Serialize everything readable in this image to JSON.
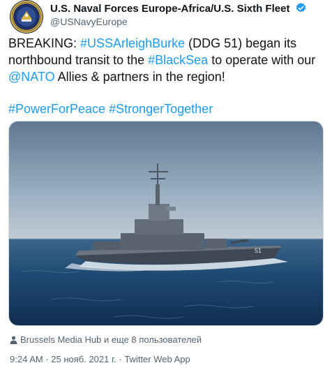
{
  "account": {
    "display_name": "U.S. Naval Forces Europe-Africa/U.S. Sixth Fleet",
    "handle": "@USNavyEurope",
    "avatar_icon": "navy-seal-avatar",
    "verified_icon": "verified-badge-icon"
  },
  "tweet": {
    "line1": {
      "prefix": "BREAKING: ",
      "hashtag1": "#USSArleighBurke",
      "mid1": " (DDG 51) began its northbound transit to the ",
      "hashtag2": "#BlackSea",
      "mid2": " to operate with our ",
      "mention": "@NATO",
      "suffix": " Allies & partners in the region!"
    },
    "line2": {
      "hashtag1": "#PowerForPeace",
      "space": " ",
      "hashtag2": "#StrongerTogether"
    }
  },
  "media": {
    "subject_icon": "destroyer-ship-photo",
    "hull_number": "51"
  },
  "tagged": {
    "icon": "person-icon",
    "text": "Brussels Media Hub и еще 8 пользователей"
  },
  "meta": {
    "time": "9:24 AM",
    "separator": " · ",
    "date": "25 нояб. 2021 г.",
    "source": "Twitter Web App"
  },
  "colors": {
    "link": "#1d9bf0",
    "text": "#0f1419",
    "secondary": "#536471",
    "border": "#cfd9de",
    "verified": "#1d9bf0"
  }
}
